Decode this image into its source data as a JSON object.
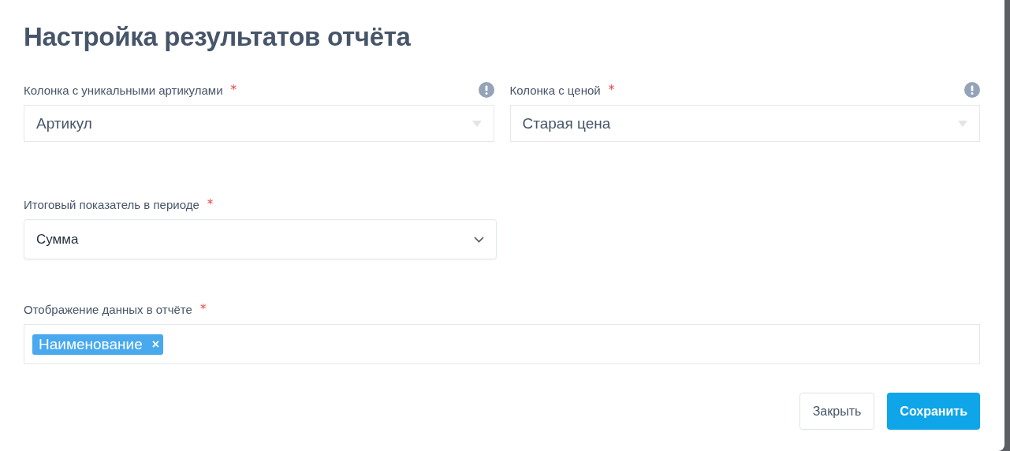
{
  "dialog": {
    "title": "Настройка результатов отчёта"
  },
  "rows": [
    {
      "fields": [
        {
          "kind": "legacy-select",
          "label": "Колонка с уникальными артикулами",
          "required_mark": "*",
          "info": true,
          "value": "Артикул"
        },
        {
          "kind": "legacy-select",
          "label": "Колонка с ценой",
          "required_mark": "*",
          "info": true,
          "value": "Старая цена"
        }
      ]
    },
    {
      "fields": [
        {
          "kind": "select",
          "label": "Итоговый показатель в периоде",
          "required_mark": "*",
          "info": false,
          "value": "Сумма"
        }
      ]
    },
    {
      "fields": [
        {
          "kind": "tags",
          "label": "Отображение данных в отчёте",
          "required_mark": "*",
          "info": false,
          "tags": [
            {
              "label": "Наименование",
              "remove": "×"
            }
          ]
        }
      ]
    }
  ],
  "buttons": [
    {
      "kind": "secondary",
      "label": "Закрыть"
    },
    {
      "kind": "primary",
      "label": "Сохранить"
    }
  ]
}
